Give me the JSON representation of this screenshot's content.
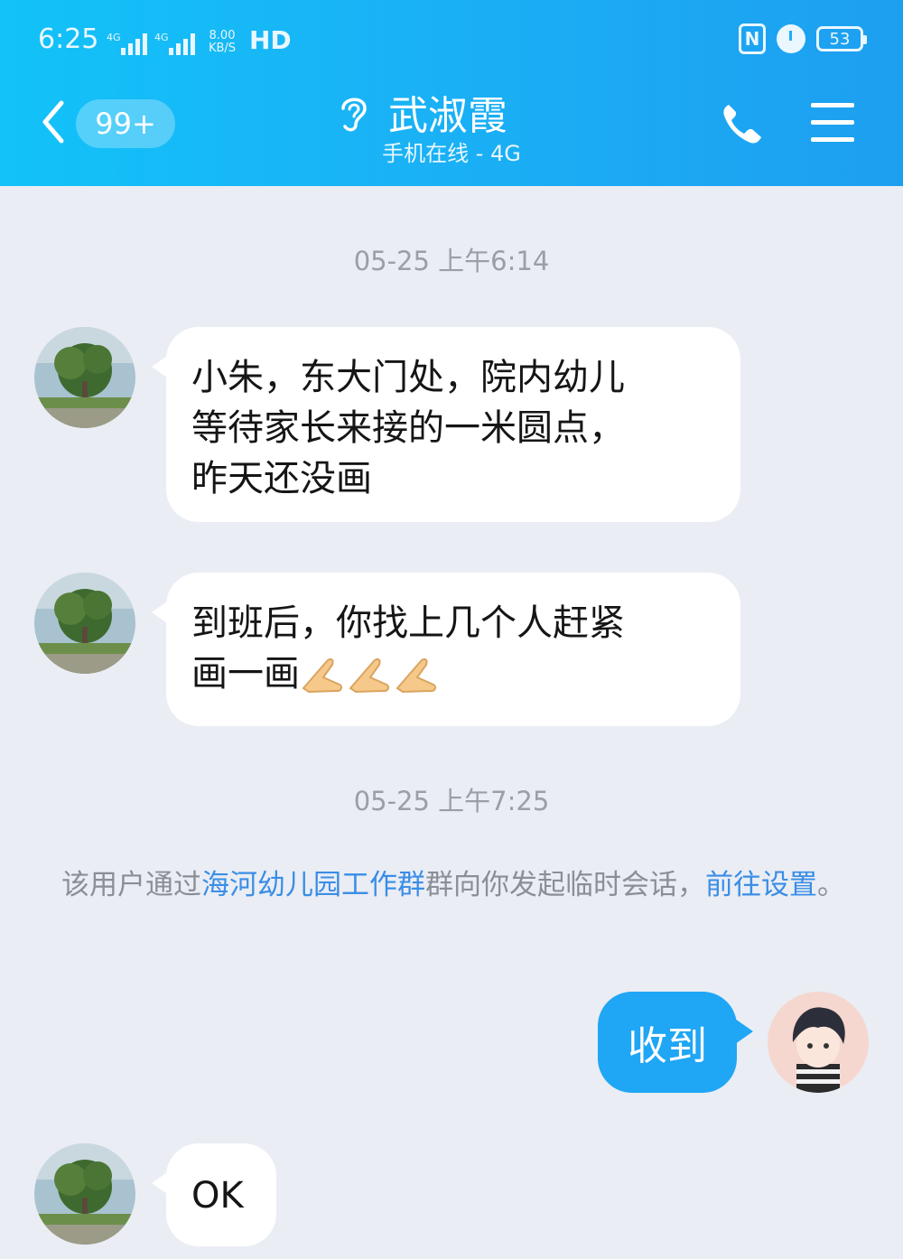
{
  "status_bar": {
    "time": "6:25",
    "signal1": "4G",
    "signal2": "4G",
    "speed_value": "8.00",
    "speed_unit": "KB/S",
    "hd": "HD",
    "nfc": "N",
    "battery": "53"
  },
  "header": {
    "badge": "99+",
    "contact_name": "武淑霞",
    "contact_status": "手机在线 - 4G"
  },
  "messages": {
    "time1": "05-25 上午6:14",
    "msg1": "小朱，东大门处，院内幼儿\n等待家长来接的一米圆点，\n昨天还没画",
    "msg2_line1": "到班后，你找上几个人赶紧",
    "msg2_line2": "画一画",
    "time2": "05-25 上午7:25",
    "sys_pre": "该用户通过",
    "sys_group": "海河幼儿园工作群",
    "sys_mid": "群向你发起临时会话，",
    "sys_link": "前往设置",
    "sys_end": "。",
    "my_reply": "收到",
    "reply_ok": "OK"
  },
  "icons": {
    "back": "chevron-left-icon",
    "ear": "ear-icon",
    "phone": "phone-icon",
    "menu": "menu-icon",
    "emoji": "pray-hands-emoji"
  },
  "colors": {
    "header_start": "#12c2f8",
    "header_end": "#1d9ff0",
    "my_bubble": "#1fa6f5",
    "link": "#3a8ee6",
    "background": "#eaedf4"
  }
}
